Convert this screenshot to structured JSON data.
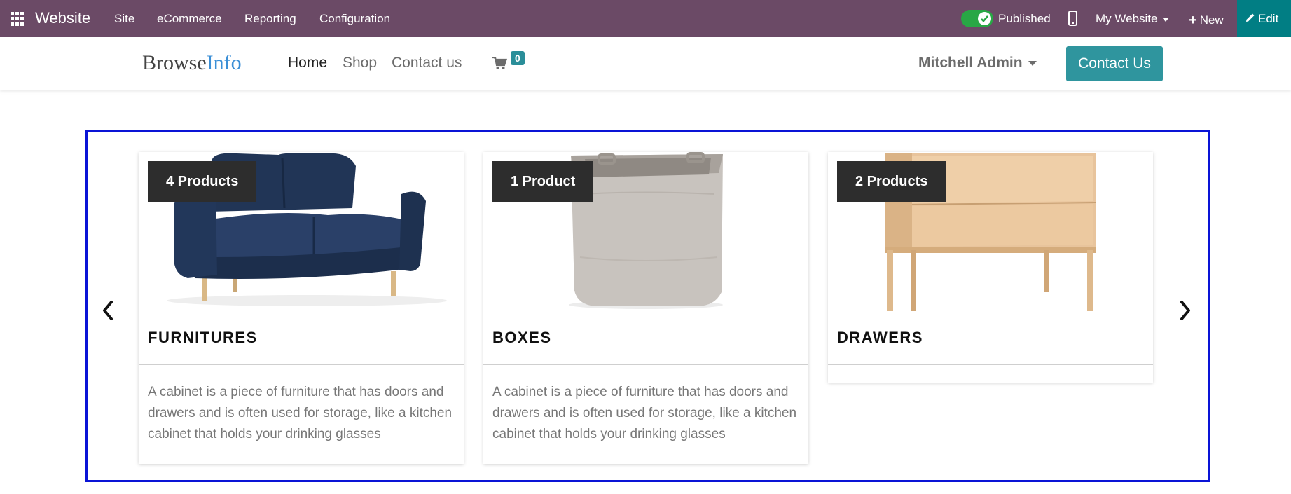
{
  "topbar": {
    "brand": "Website",
    "menus": [
      "Site",
      "eCommerce",
      "Reporting",
      "Configuration"
    ],
    "published_label": "Published",
    "my_website_label": "My Website",
    "new_label": "New",
    "edit_label": "Edit",
    "color": "#6b4a66",
    "edit_color": "#017e84"
  },
  "header": {
    "logo_part1": "Browse",
    "logo_part2": "Info",
    "nav": [
      "Home",
      "Shop",
      "Contact us"
    ],
    "cart_count": "0",
    "user_name": "Mitchell Admin",
    "contact_button": "Contact Us",
    "accent": "#2f959e"
  },
  "carousel": {
    "cards": [
      {
        "badge": "4 Products",
        "title": "FURNITURES",
        "description": "A cabinet is a piece of furniture that has doors and drawers and is often used for storage, like a kitchen cabinet that holds your drinking glasses",
        "image": "sofa"
      },
      {
        "badge": "1 Product",
        "title": "BOXES",
        "description": "A cabinet is a piece of furniture that has doors and drawers and is often used for storage, like a kitchen cabinet that holds your drinking glasses",
        "image": "fabric-basket"
      },
      {
        "badge": "2 Products",
        "title": "DRAWERS",
        "description": "",
        "image": "wooden-drawer-cabinet"
      }
    ]
  }
}
